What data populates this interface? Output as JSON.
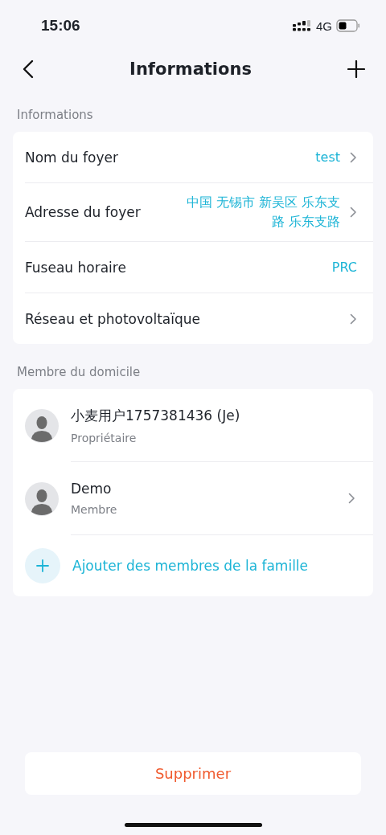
{
  "status_bar": {
    "time": "15:06",
    "network": "4G"
  },
  "nav": {
    "title": "Informations"
  },
  "info_section": {
    "heading": "Informations",
    "rows": [
      {
        "label": "Nom du foyer",
        "value": "test",
        "chevron": true
      },
      {
        "label": "Adresse du foyer",
        "value": "中国 无锡市 新吴区 乐东支路 乐东支路",
        "chevron": true
      },
      {
        "label": "Fuseau horaire",
        "value": "PRC",
        "chevron": false
      },
      {
        "label": "Réseau et photovoltaïque",
        "chevron": true
      }
    ]
  },
  "members_section": {
    "heading": "Membre du domicile",
    "members": [
      {
        "name": "小麦用户1757381436 (Je)",
        "role": "Propriétaire",
        "chevron": false
      },
      {
        "name": "Demo",
        "role": "Membre",
        "chevron": true
      }
    ],
    "add_label": "Ajouter des membres de la famille"
  },
  "delete_button": "Supprimer"
}
